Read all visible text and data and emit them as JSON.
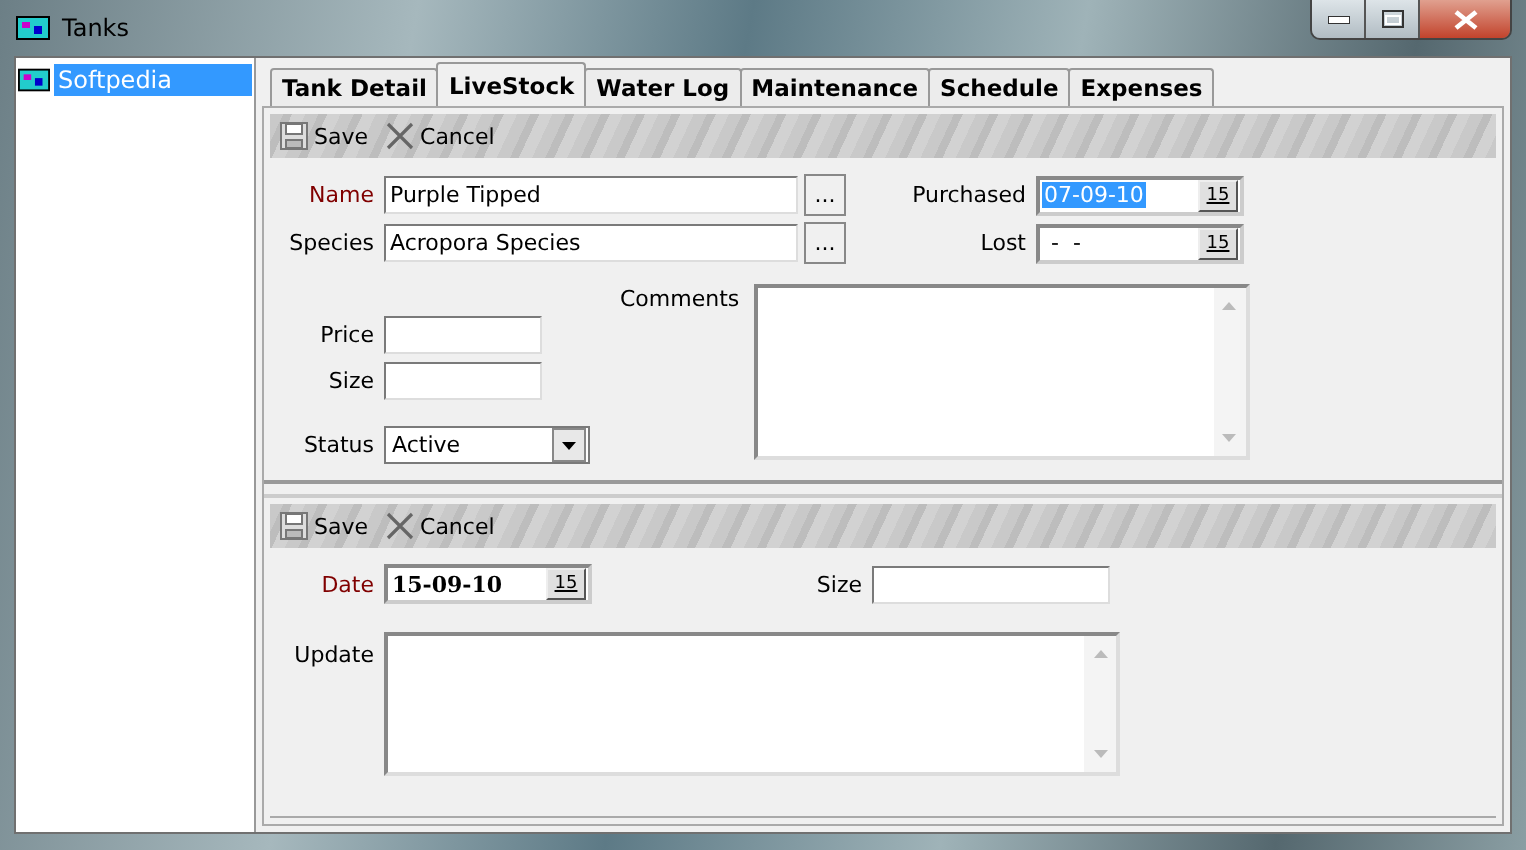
{
  "window": {
    "title": "Tanks"
  },
  "tree": {
    "items": [
      {
        "label": "Softpedia",
        "selected": true
      }
    ]
  },
  "tabs": [
    {
      "label": "Tank Detail",
      "selected": false
    },
    {
      "label": "LiveStock",
      "selected": true
    },
    {
      "label": "Water Log",
      "selected": false
    },
    {
      "label": "Maintenance",
      "selected": false
    },
    {
      "label": "Schedule",
      "selected": false
    },
    {
      "label": "Expenses",
      "selected": false
    }
  ],
  "livestock": {
    "toolbar": [
      {
        "kind": "save",
        "label": "Save"
      },
      {
        "kind": "cancel",
        "label": "Cancel"
      }
    ],
    "name": {
      "label": "Name",
      "value": "Purple Tipped",
      "required": true,
      "button": "..."
    },
    "species": {
      "label": "Species",
      "value": "Acropora Species",
      "required": false,
      "button": "..."
    },
    "purchased": {
      "label": "Purchased",
      "value": "07-09-10",
      "highlighted": true,
      "calendar": "15"
    },
    "lost": {
      "label": "Lost",
      "value": " -  -",
      "highlighted": false,
      "calendar": "15"
    },
    "price": {
      "label": "Price"
    },
    "size": {
      "label": "Size"
    },
    "status": {
      "label": "Status",
      "value": "Active"
    },
    "comments": {
      "label": "Comments"
    }
  },
  "updates": {
    "toolbar": [
      {
        "kind": "save",
        "label": "Save"
      },
      {
        "kind": "cancel",
        "label": "Cancel"
      }
    ],
    "date": {
      "label": "Date",
      "value": "15-09-10",
      "required": true,
      "calendar": "15"
    },
    "size": {
      "label": "Size"
    },
    "update": {
      "label": "Update"
    }
  }
}
